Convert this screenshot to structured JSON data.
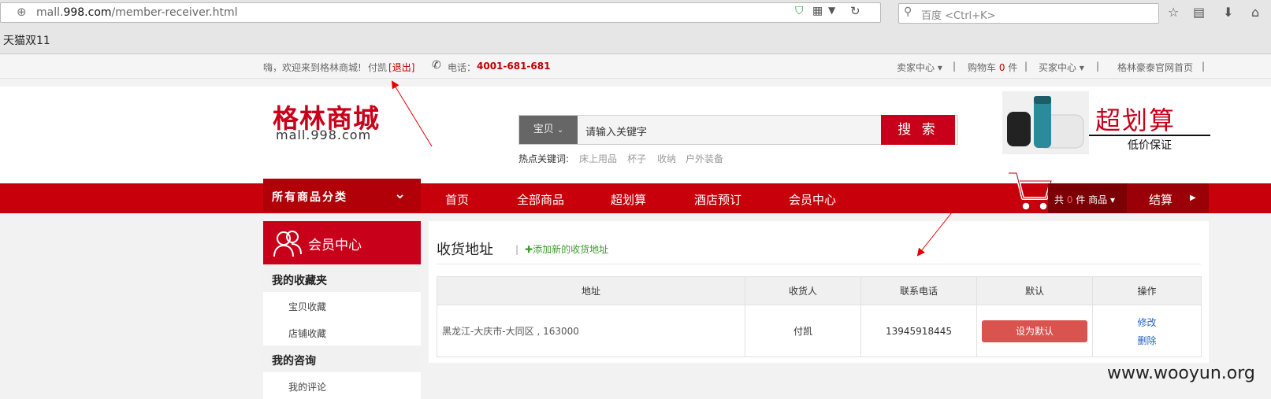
{
  "browser": {
    "url_prefix": "mall.",
    "url_domain": "998.com",
    "url_path": "/member-receiver.html",
    "search_placeholder": "百度 <Ctrl+K>",
    "tab_title": "天猫双11"
  },
  "topbar": {
    "welcome": "嗨，欢迎来到格林商城!",
    "user": "付凯",
    "logout_open": "[",
    "logout": "退出",
    "logout_close": "]",
    "phone_label": "电话：",
    "phone": "4001-681-681",
    "seller_center": "卖家中心",
    "cart_label": "购物车",
    "cart_count": "0",
    "cart_unit": "件",
    "buyer_center": "买家中心",
    "homepage": "格林豪泰官网首页",
    "sep": "|"
  },
  "header": {
    "logo_cn": "格林商城",
    "logo_en": "mall.998.com",
    "search_category": "宝贝",
    "search_input": "请输入关键字",
    "search_button": "搜 索",
    "hot_label": "热点关键词:",
    "hot_keywords": [
      "床上用品",
      "杯子",
      "收纳",
      "户外装备"
    ],
    "promo_title": "超划算",
    "promo_sub": "低价保证"
  },
  "nav": {
    "all_categories": "所有商品分类",
    "items": [
      "首页",
      "全部商品",
      "超划算",
      "酒店预订",
      "会员中心"
    ],
    "cart_prefix": "共",
    "cart_count": "0",
    "cart_suffix": "件 商品",
    "checkout": "结算"
  },
  "sidebar": {
    "title": "会员中心",
    "groups": [
      {
        "label": "我的收藏夹",
        "items": [
          "宝贝收藏",
          "店铺收藏"
        ]
      },
      {
        "label": "我的咨询",
        "items": [
          "我的评论"
        ]
      }
    ]
  },
  "main": {
    "title": "收货地址",
    "separator": "|",
    "add_link": "添加新的收货地址",
    "table": {
      "headers": [
        "地址",
        "收货人",
        "联系电话",
        "默认",
        "操作"
      ],
      "rows": [
        {
          "address": "黑龙江-大庆市-大同区 , 163000",
          "receiver": "付凯",
          "phone": "13945918445",
          "default_button": "设为默认",
          "edit": "修改",
          "delete": "删除"
        }
      ]
    }
  },
  "watermark": "www.wooyun.org",
  "colors": {
    "brand_red": "#c8001a",
    "nav_red": "#c8000b",
    "link_blue": "#2a64c2",
    "add_green": "#3a9a2a"
  }
}
